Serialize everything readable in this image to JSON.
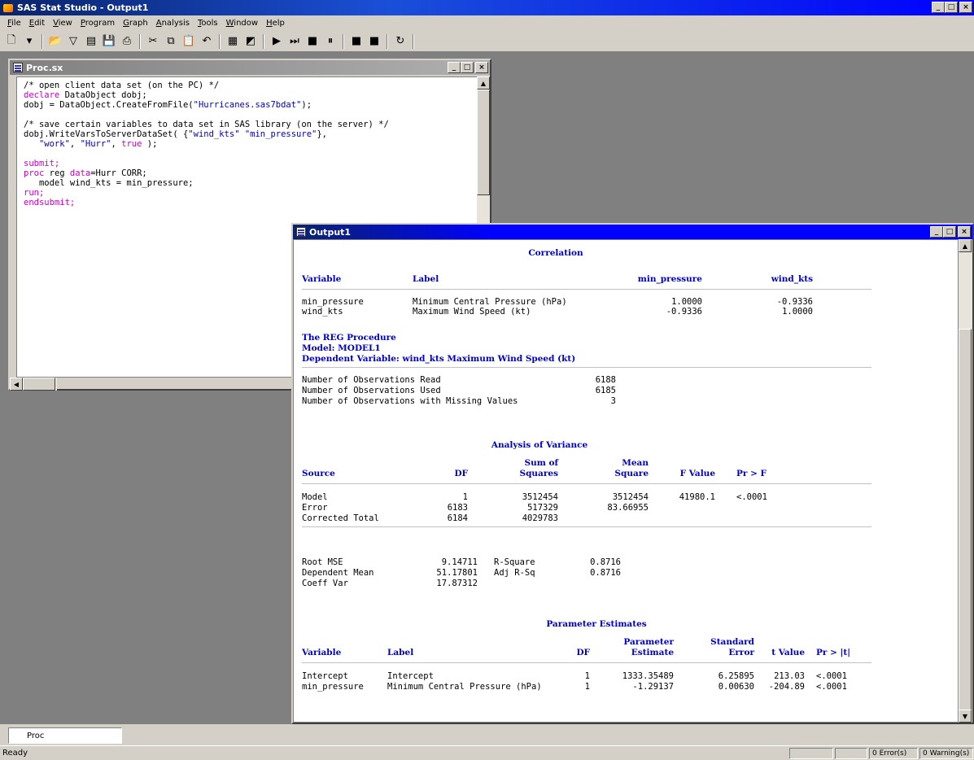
{
  "app": {
    "title": "SAS Stat Studio - Output1"
  },
  "window_buttons": {
    "minimize": "_",
    "maximize": "□",
    "close": "×"
  },
  "menu": [
    {
      "label": "File",
      "key": "F"
    },
    {
      "label": "Edit",
      "key": "E"
    },
    {
      "label": "View",
      "key": "V"
    },
    {
      "label": "Program",
      "key": "P"
    },
    {
      "label": "Graph",
      "key": "G"
    },
    {
      "label": "Analysis",
      "key": "A"
    },
    {
      "label": "Tools",
      "key": "T"
    },
    {
      "label": "Window",
      "key": "W"
    },
    {
      "label": "Help",
      "key": "H"
    }
  ],
  "toolbar": [
    {
      "name": "new-icon",
      "glyph": "🗋"
    },
    {
      "name": "dropdown-arrow-icon",
      "glyph": "▾"
    },
    {
      "name": "open-folder-icon",
      "glyph": "📂"
    },
    {
      "name": "filter-icon",
      "glyph": "▽"
    },
    {
      "name": "data-icon",
      "glyph": "▤"
    },
    {
      "name": "save-icon",
      "glyph": "💾"
    },
    {
      "name": "print-icon",
      "glyph": "⎙"
    },
    {
      "name": "cut-icon",
      "glyph": "✂"
    },
    {
      "name": "copy-icon",
      "glyph": "⧉"
    },
    {
      "name": "paste-icon",
      "glyph": "📋"
    },
    {
      "name": "undo-icon",
      "glyph": "↶"
    },
    {
      "name": "grid-icon",
      "glyph": "▦"
    },
    {
      "name": "chart-icon",
      "glyph": "◩"
    },
    {
      "name": "run-icon",
      "glyph": "▶"
    },
    {
      "name": "step-icon",
      "glyph": "⏭"
    },
    {
      "name": "stop-icon",
      "glyph": "■"
    },
    {
      "name": "pause-icon",
      "glyph": "⏸"
    },
    {
      "name": "break-icon",
      "glyph": "■"
    },
    {
      "name": "block-icon",
      "glyph": "■"
    },
    {
      "name": "refresh-icon",
      "glyph": "↻"
    }
  ],
  "editor_window": {
    "title": "Proc.sx",
    "code": [
      [
        {
          "t": "/* open client data set (on the PC) */",
          "c": "cm"
        }
      ],
      [
        {
          "t": "declare",
          "c": "kw"
        },
        {
          "t": " DataObject dobj;",
          "c": ""
        }
      ],
      [
        {
          "t": "dobj = DataObject.CreateFromFile(",
          "c": ""
        },
        {
          "t": "\"Hurricanes.sas7bdat\"",
          "c": "str"
        },
        {
          "t": ");",
          "c": ""
        }
      ],
      [
        {
          "t": "",
          "c": ""
        }
      ],
      [
        {
          "t": "/* save certain variables to data set in SAS library (on the server) */",
          "c": "cm"
        }
      ],
      [
        {
          "t": "dobj.WriteVarsToServerDataSet( {",
          "c": ""
        },
        {
          "t": "\"wind_kts\"",
          "c": "str"
        },
        {
          "t": " ",
          "c": ""
        },
        {
          "t": "\"min_pressure\"",
          "c": "str"
        },
        {
          "t": "},",
          "c": ""
        }
      ],
      [
        {
          "t": "   ",
          "c": ""
        },
        {
          "t": "\"work\"",
          "c": "str"
        },
        {
          "t": ", ",
          "c": ""
        },
        {
          "t": "\"Hurr\"",
          "c": "str"
        },
        {
          "t": ", ",
          "c": ""
        },
        {
          "t": "true",
          "c": "kw"
        },
        {
          "t": " );",
          "c": ""
        }
      ],
      [
        {
          "t": "",
          "c": ""
        }
      ],
      [
        {
          "t": "submit;",
          "c": "kw"
        }
      ],
      [
        {
          "t": "proc",
          "c": "kw"
        },
        {
          "t": " reg ",
          "c": ""
        },
        {
          "t": "data",
          "c": "kw"
        },
        {
          "t": "=Hurr CORR;",
          "c": ""
        }
      ],
      [
        {
          "t": "   model wind_kts = min_pressure;",
          "c": ""
        }
      ],
      [
        {
          "t": "run;",
          "c": "kw"
        }
      ],
      [
        {
          "t": "endsubmit;",
          "c": "kw"
        }
      ]
    ]
  },
  "output_window": {
    "title": "Output1",
    "correlation": {
      "title": "Correlation",
      "headers": [
        "Variable",
        "Label",
        "min_pressure",
        "wind_kts"
      ],
      "rows": [
        [
          "min_pressure",
          "Minimum Central Pressure (hPa)",
          "1.0000",
          "-0.9336"
        ],
        [
          "wind_kts",
          "Maximum Wind Speed (kt)",
          "-0.9336",
          "1.0000"
        ]
      ]
    },
    "reg_header": [
      "The REG Procedure",
      "Model: MODEL1",
      "Dependent Variable: wind_kts Maximum Wind Speed (kt)"
    ],
    "observations": [
      [
        "Number of Observations Read",
        "6188"
      ],
      [
        "Number of Observations Used",
        "6185"
      ],
      [
        "Number of Observations with Missing Values",
        "3"
      ]
    ],
    "anova": {
      "title": "Analysis of Variance",
      "header_top": [
        "Sum of",
        "Mean"
      ],
      "headers": [
        "Source",
        "DF",
        "Squares",
        "Square",
        "F Value",
        "Pr > F"
      ],
      "rows": [
        [
          "Model",
          "1",
          "3512454",
          "3512454",
          "41980.1",
          "<.0001"
        ],
        [
          "Error",
          "6183",
          "517329",
          "83.66955",
          "",
          ""
        ],
        [
          "Corrected Total",
          "6184",
          "4029783",
          "",
          "",
          ""
        ]
      ]
    },
    "fit": [
      [
        "Root MSE",
        "9.14711",
        "R-Square",
        "0.8716"
      ],
      [
        "Dependent Mean",
        "51.17801",
        "Adj R-Sq",
        "0.8716"
      ],
      [
        "Coeff Var",
        "17.87312",
        "",
        ""
      ]
    ],
    "params": {
      "title": "Parameter Estimates",
      "header_top": [
        "Parameter",
        "Standard"
      ],
      "headers": [
        "Variable",
        "Label",
        "DF",
        "Estimate",
        "Error",
        "t Value",
        "Pr > |t|"
      ],
      "rows": [
        [
          "Intercept",
          "Intercept",
          "1",
          "1333.35489",
          "6.25895",
          "213.03",
          "<.0001"
        ],
        [
          "min_pressure",
          "Minimum Central Pressure (hPa)",
          "1",
          "-1.29137",
          "0.00630",
          "-204.89",
          "<.0001"
        ]
      ]
    }
  },
  "task_tab": {
    "label": "Proc"
  },
  "status": {
    "text": "Ready",
    "errors": "0 Error(s)",
    "warnings": "0 Warning(s)"
  }
}
